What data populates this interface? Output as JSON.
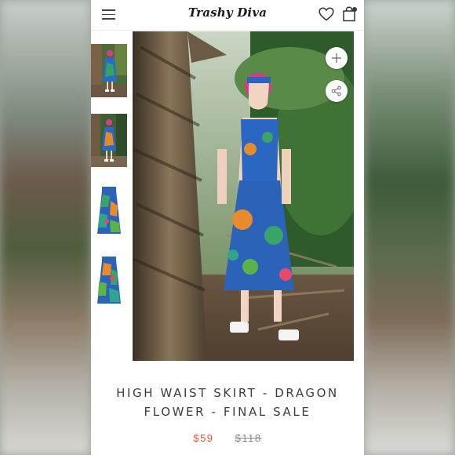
{
  "header": {
    "brand": "Trashy Diva",
    "menu_icon": "hamburger-icon",
    "wishlist_icon": "heart-icon",
    "cart_icon": "shopping-bag-icon"
  },
  "gallery": {
    "thumbnails": [
      {
        "name": "front-view-thumbnail"
      },
      {
        "name": "full-length-thumbnail"
      },
      {
        "name": "skirt-front-thumbnail"
      },
      {
        "name": "skirt-back-thumbnail"
      }
    ],
    "zoom_icon": "plus-icon",
    "share_icon": "share-icon"
  },
  "product": {
    "title_line1": "HIGH WAIST SKIRT - DRAGON",
    "title_line2": "FLOWER - FINAL SALE",
    "price": "$59",
    "compare_at_price": "$118"
  },
  "colors": {
    "price": "#e2543a",
    "title": "#3c3c3c",
    "compare_price": "#8a8a8a"
  }
}
